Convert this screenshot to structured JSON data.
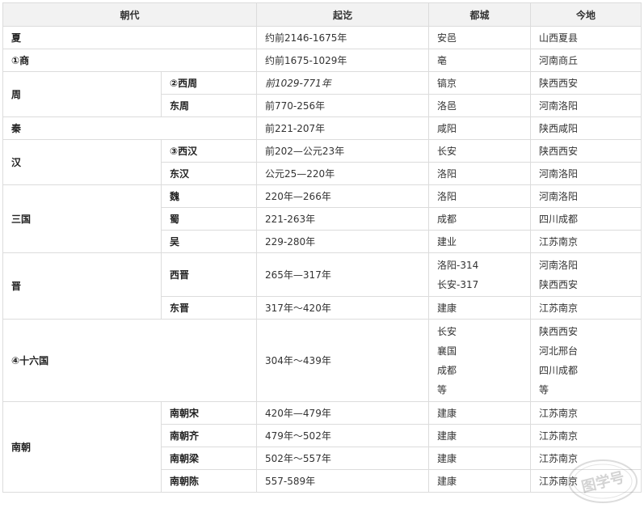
{
  "headers": [
    "朝代",
    "起讫",
    "都城",
    "今地"
  ],
  "rows": {
    "xia": {
      "name": "夏",
      "period": "约前2146-1675年",
      "capital": "安邑",
      "today": "山西夏县"
    },
    "shang": {
      "name": "①商",
      "period": "约前1675-1029年",
      "capital": "亳",
      "today": "河南商丘"
    },
    "zhou": {
      "name": "周",
      "west": {
        "name": "②西周",
        "period": "前1029-771年",
        "capital": "镐京",
        "today": "陕西西安"
      },
      "east": {
        "name": "东周",
        "period": "前770-256年",
        "capital": "洛邑",
        "today": "河南洛阳"
      }
    },
    "qin": {
      "name": "秦",
      "period": "前221-207年",
      "capital": "咸阳",
      "today": "陕西咸阳"
    },
    "han": {
      "name": "汉",
      "west": {
        "name": "③西汉",
        "period": "前202—公元23年",
        "capital": "长安",
        "today": "陕西西安"
      },
      "east": {
        "name": "东汉",
        "period": "公元25—220年",
        "capital": "洛阳",
        "today": "河南洛阳"
      }
    },
    "sanguo": {
      "name": "三国",
      "wei": {
        "name": "魏",
        "period": "220年—266年",
        "capital": "洛阳",
        "today": "河南洛阳"
      },
      "shu": {
        "name": "蜀",
        "period": "221-263年",
        "capital": "成都",
        "today": "四川成都"
      },
      "wu": {
        "name": "吴",
        "period": "229-280年",
        "capital": "建业",
        "today": "江苏南京"
      }
    },
    "jin": {
      "name": "晋",
      "west": {
        "name": "西晋",
        "period": "265年—317年",
        "capital1": "洛阳-314",
        "capital2": "长安-317",
        "today1": "河南洛阳",
        "today2": "陕西西安"
      },
      "east": {
        "name": "东晋",
        "period": "317年～420年",
        "capital": "建康",
        "today": "江苏南京"
      }
    },
    "sixteen": {
      "name": "④十六国",
      "period": "304年～439年",
      "capitals": [
        "长安",
        "襄国",
        "成都",
        "等"
      ],
      "todays": [
        "陕西西安",
        "河北邢台",
        "四川成都",
        "等"
      ]
    },
    "nanchao": {
      "name": "南朝",
      "song": {
        "name": "南朝宋",
        "period": "420年—479年",
        "capital": "建康",
        "today": "江苏南京"
      },
      "qi": {
        "name": "南朝齐",
        "period": "479年～502年",
        "capital": "建康",
        "today": "江苏南京"
      },
      "liang": {
        "name": "南朝梁",
        "period": "502年～557年",
        "capital": "建康",
        "today": "江苏南京"
      },
      "chen": {
        "name": "南朝陈",
        "period": "557-589年",
        "capital": "建康",
        "today": "江苏南京"
      }
    }
  },
  "watermark": {
    "text": "图学号"
  }
}
